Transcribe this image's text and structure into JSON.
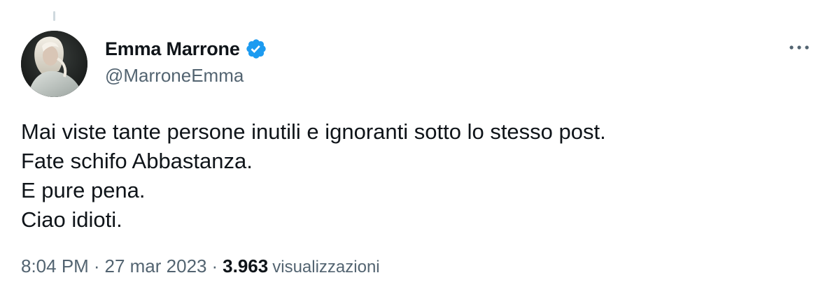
{
  "tweet": {
    "author": {
      "display_name": "Emma Marrone",
      "handle": "@MarroneEmma",
      "verified": true,
      "avatar_icon": "profile-photo"
    },
    "text_lines": [
      "Mai viste tante persone inutili e ignoranti sotto lo stesso post.",
      "Fate schifo Abbastanza.",
      "E pure pena.",
      "Ciao idioti."
    ],
    "time": "8:04 PM",
    "date": "27 mar 2023",
    "separator": "·",
    "views_count": "3.963",
    "views_label": "visualizzazioni",
    "more_icon": "more-horizontal-icon"
  },
  "colors": {
    "text_primary": "#0f1419",
    "text_secondary": "#536471",
    "verified_blue": "#1d9bf0",
    "thread_line": "#cfd9de",
    "background": "#ffffff"
  }
}
